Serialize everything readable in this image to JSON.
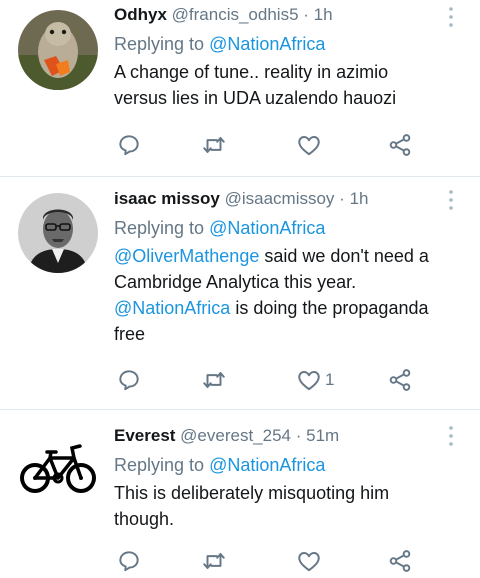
{
  "colors": {
    "link": "#1b95e0",
    "secondary": "#657786",
    "text": "#14171a",
    "divider": "#e1e8ed"
  },
  "tweets": [
    {
      "name": "Odhyx",
      "handle": "@francis_odhis5",
      "time": "1h",
      "replying_prefix": "Replying to ",
      "replying_to": "@NationAfrica",
      "text": "A change of tune.. reality in azimio versus lies in UDA uzalendo hauozi",
      "like_count": ""
    },
    {
      "name": "isaac missoy",
      "handle": "@isaacmissoy",
      "time": "1h",
      "replying_prefix": "Replying to ",
      "replying_to": "@NationAfrica",
      "text_mention_1": "@OliverMathenge",
      "text_part_1": " said we don't need a Cambridge Analytica this year.",
      "text_mention_2": "@NationAfrica",
      "text_part_2": " is doing the propaganda free",
      "like_count": "1"
    },
    {
      "name": "Everest",
      "handle": "@everest_254",
      "time": "51m",
      "replying_prefix": "Replying to ",
      "replying_to": "@NationAfrica",
      "text": "This is deliberately misquoting him though.",
      "like_count": ""
    }
  ],
  "icons": [
    "reply-icon",
    "retweet-icon",
    "like-icon",
    "share-icon",
    "more-caret-icon"
  ]
}
